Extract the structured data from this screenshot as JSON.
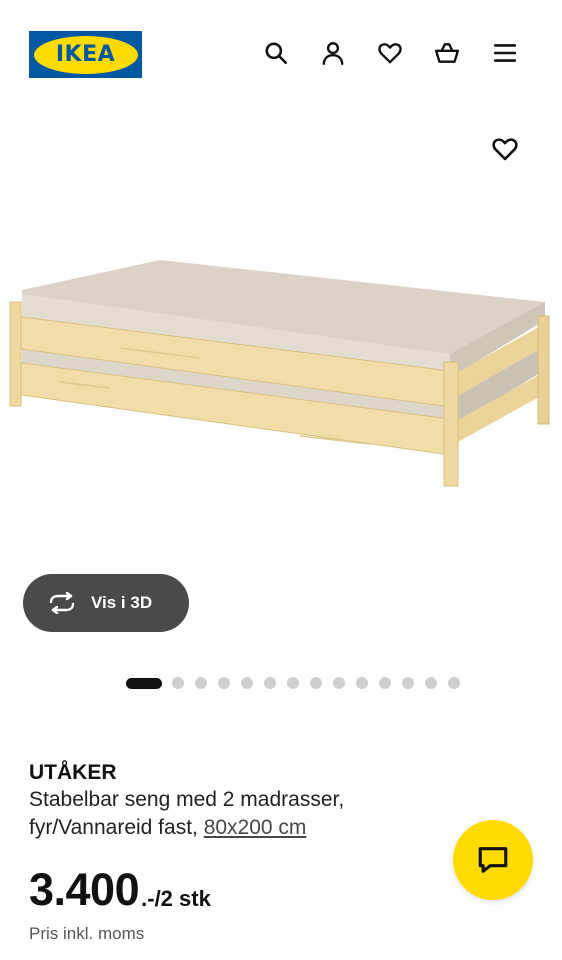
{
  "header": {
    "logo_text": "IKEA",
    "icons": [
      "search-icon",
      "account-icon",
      "favorites-icon",
      "cart-icon",
      "menu-icon"
    ]
  },
  "gallery": {
    "view_3d_label": "Vis i 3D",
    "total_images": 14,
    "active_index": 0
  },
  "product": {
    "name": "UTÅKER",
    "description_line1": "Stabelbar seng med 2 madrasser,",
    "description_line2": "fyr/Vannareid fast, ",
    "size_link": "80x200 cm"
  },
  "price": {
    "amount": "3.400",
    "suffix": ".-/2 stk",
    "note": "Pris inkl. moms"
  },
  "colors": {
    "ikea_blue": "#0058a3",
    "ikea_yellow": "#ffdb00"
  }
}
